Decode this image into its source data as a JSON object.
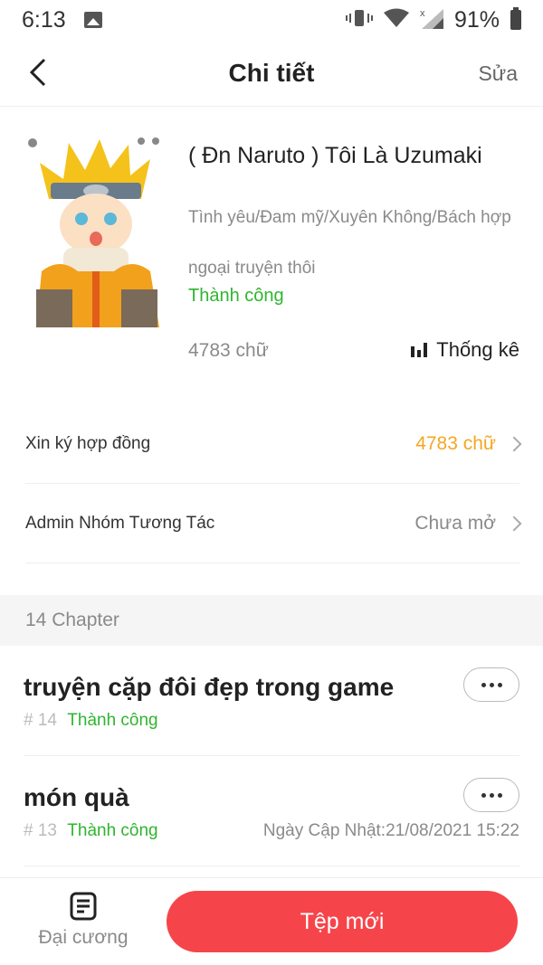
{
  "status_bar": {
    "time": "6:13",
    "battery": "91%"
  },
  "header": {
    "title": "Chi tiết",
    "edit_label": "Sửa"
  },
  "book": {
    "title": "( Đn Naruto ) Tôi Là Uzumaki",
    "genres": "Tình yêu/Đam mỹ/Xuyên Không/Bách hợp",
    "description": "ngoại truyện thôi",
    "status": "Thành công",
    "word_count": "4783 chữ",
    "stats_label": "Thống kê"
  },
  "menu": {
    "contract_label": "Xin ký hợp đồng",
    "contract_value": "4783 chữ",
    "admin_label": "Admin Nhóm Tương Tác",
    "admin_value": "Chưa mở"
  },
  "chapters_header": "14 Chapter",
  "chapters": [
    {
      "title": "truyện cặp đôi đẹp trong game",
      "number": "# 14",
      "status": "Thành công",
      "updated": ""
    },
    {
      "title": "món quà",
      "number": "# 13",
      "status": "Thành công",
      "updated": "Ngày Cập Nhật:21/08/2021 15:22"
    }
  ],
  "bottom": {
    "outline_label": "Đại cương",
    "new_file_label": "Tệp mới"
  },
  "colors": {
    "accent": "#f6454a",
    "success": "#2fb52f",
    "warning": "#f5a623"
  }
}
